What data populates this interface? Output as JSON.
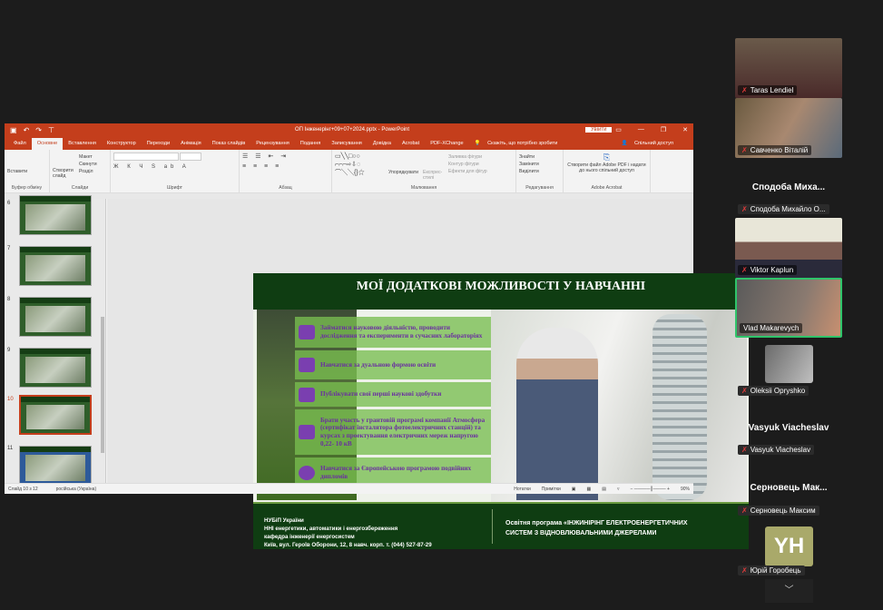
{
  "ppt": {
    "title": "ОП Інженерінг+09+07+2024.pptx - PowerPoint",
    "login": "Увійти",
    "tabs": [
      "Файл",
      "Основне",
      "Вставлення",
      "Конструктор",
      "Переходи",
      "Анімація",
      "Показ слайдів",
      "Рецензування",
      "Подання",
      "Записування",
      "Довідка",
      "Acrobat",
      "PDF-XChange"
    ],
    "tell_me": "Скажіть, що потрібно зробити",
    "share": "Спільний доступ",
    "ribbon": {
      "paste": "Вставити",
      "clipboard": "Буфер обміну",
      "new_slide": "Створити слайд",
      "layout": "Макет",
      "reset": "Скинути",
      "section": "Розділ",
      "slides": "Слайди",
      "font": "Шрифт",
      "paragraph": "Абзац",
      "arrange": "Упорядкувати",
      "quick_styles": "Експрес-стилі",
      "fill": "Заливка фігури",
      "outline": "Контур фігури",
      "effects": "Ефекти для фігур",
      "drawing": "Малювання",
      "find": "Знайти",
      "replace": "Замінити",
      "select": "Виділити",
      "editing": "Редагування",
      "adobe_create": "Створити файл Adobe PDF і надати до нього спільний доступ",
      "adobe": "Adobe Acrobat"
    },
    "thumbnails": [
      {
        "n": "6"
      },
      {
        "n": "7"
      },
      {
        "n": "8"
      },
      {
        "n": "9"
      },
      {
        "n": "10",
        "selected": true
      },
      {
        "n": "11"
      }
    ],
    "slide": {
      "title": "МОЇ ДОДАТКОВІ МОЖЛИВОСТІ У НАВЧАННІ",
      "items": [
        {
          "icon": "pencil-icon",
          "text": "Займатися науковою діяльністю, проводити дослідження та експерименти в  сучасних лабораторіях"
        },
        {
          "icon": "graduation-cap-icon",
          "text": "Навчатися за дуальною формою освіти"
        },
        {
          "icon": "pencil-icon",
          "text": "Публікувати свої перші наукові здобутки"
        },
        {
          "icon": "book-icon",
          "text": "Брати участь у грантовій програмі компанії Атмосфера (сертифікат інсталятора фотоелектричних станцій) та курсах з проектування електричних мереж напругою 0,22- 10 кВ"
        },
        {
          "icon": "globe-icon",
          "text": "Навчатися за Європейською програмою подвійних дипломів"
        }
      ],
      "footer_left": [
        "НУБіП України",
        "ННІ енергетики, автоматики і енергозбереження",
        "кафедра інженерії енергосистем",
        "Київ, вул. Героїв Оборони, 12, 8 навч. корп. т. (044) 527-87-29"
      ],
      "footer_right": [
        "Освітня програма «ІНЖИНІРІНГ ЕЛЕКТРОЕНЕРГЕТИЧНИХ",
        "СИСТЕМ З ВІДНОВЛЮВАЛЬНИМИ ДЖЕРЕЛАМИ"
      ]
    },
    "status": {
      "slide": "Слайд 10 з 12",
      "lang": "російська (Україна)",
      "notes": "Нотатки",
      "comments": "Примітки",
      "zoom": "90%"
    }
  },
  "participants": [
    {
      "name": "Taras Lendiel"
    },
    {
      "name": "Савченко Віталій"
    },
    {
      "title": "Сподоба  Миха...",
      "name": "Сподоба Михайло О..."
    },
    {
      "name": "Viktor Kaplun"
    },
    {
      "name": "Vlad Makarevych"
    },
    {
      "name": "Oleksii Opryshko"
    },
    {
      "title": "Vasyuk Viacheslav",
      "name": "Vasyuk Viacheslav"
    },
    {
      "title": "Серновець  Мак...",
      "name": "Серновець Максим"
    },
    {
      "initials": "YH",
      "name": "Юрій Горобець"
    }
  ],
  "colors": {
    "ppt_accent": "#c43e1c",
    "slide_green": "#0f3d12",
    "active_speaker": "#2fc46a"
  }
}
